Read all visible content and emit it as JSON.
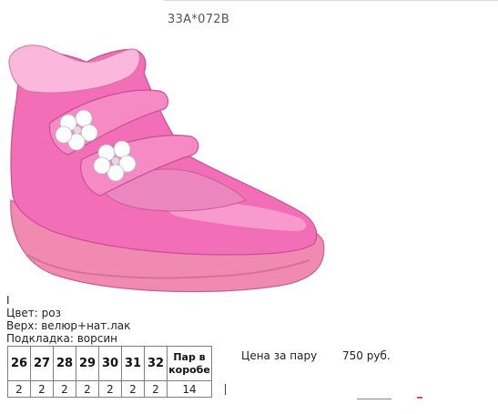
{
  "product": {
    "article": "33A*072B",
    "cursor": "I",
    "color_line": "Цвет: роз",
    "upper_line": "Верх: велюр+нат.лак",
    "lining_line": "Подкладка: ворсин",
    "image_icon": "pink-child-boot"
  },
  "sizes_table": {
    "headers": [
      "26",
      "27",
      "28",
      "29",
      "30",
      "31",
      "32"
    ],
    "box_header": "Пар в коробе",
    "quantities": [
      "2",
      "2",
      "2",
      "2",
      "2",
      "2",
      "2"
    ],
    "box_quantity": "14"
  },
  "price": {
    "label": "Цена за пару",
    "value": "750 руб."
  },
  "colors": {
    "boot_main": "#f26fb7",
    "boot_dark": "#d94b9a",
    "boot_light": "#fbb8dc",
    "sole": "#f08ab0"
  }
}
